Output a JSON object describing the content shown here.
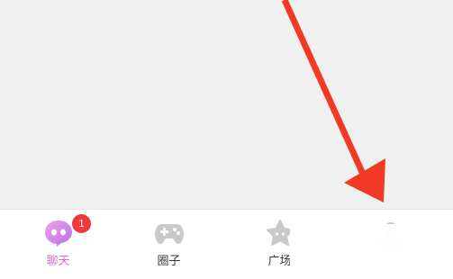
{
  "tabbar": {
    "tabs": [
      {
        "label": "聊天",
        "icon": "chat-bubble-icon",
        "active": true
      },
      {
        "label": "圈子",
        "icon": "gamepad-icon",
        "active": false
      },
      {
        "label": "广场",
        "icon": "star-icon",
        "active": false
      },
      {
        "label": "",
        "icon": "profile-icon",
        "active": false
      }
    ],
    "chat_badge": "1"
  },
  "colors": {
    "background": "#f1f0f1",
    "tabbar": "#ffffff",
    "active_tab": "#d874c8",
    "inactive_icon": "#c9c9c9",
    "badge": "#f03a3a",
    "arrow": "#f03a23"
  }
}
